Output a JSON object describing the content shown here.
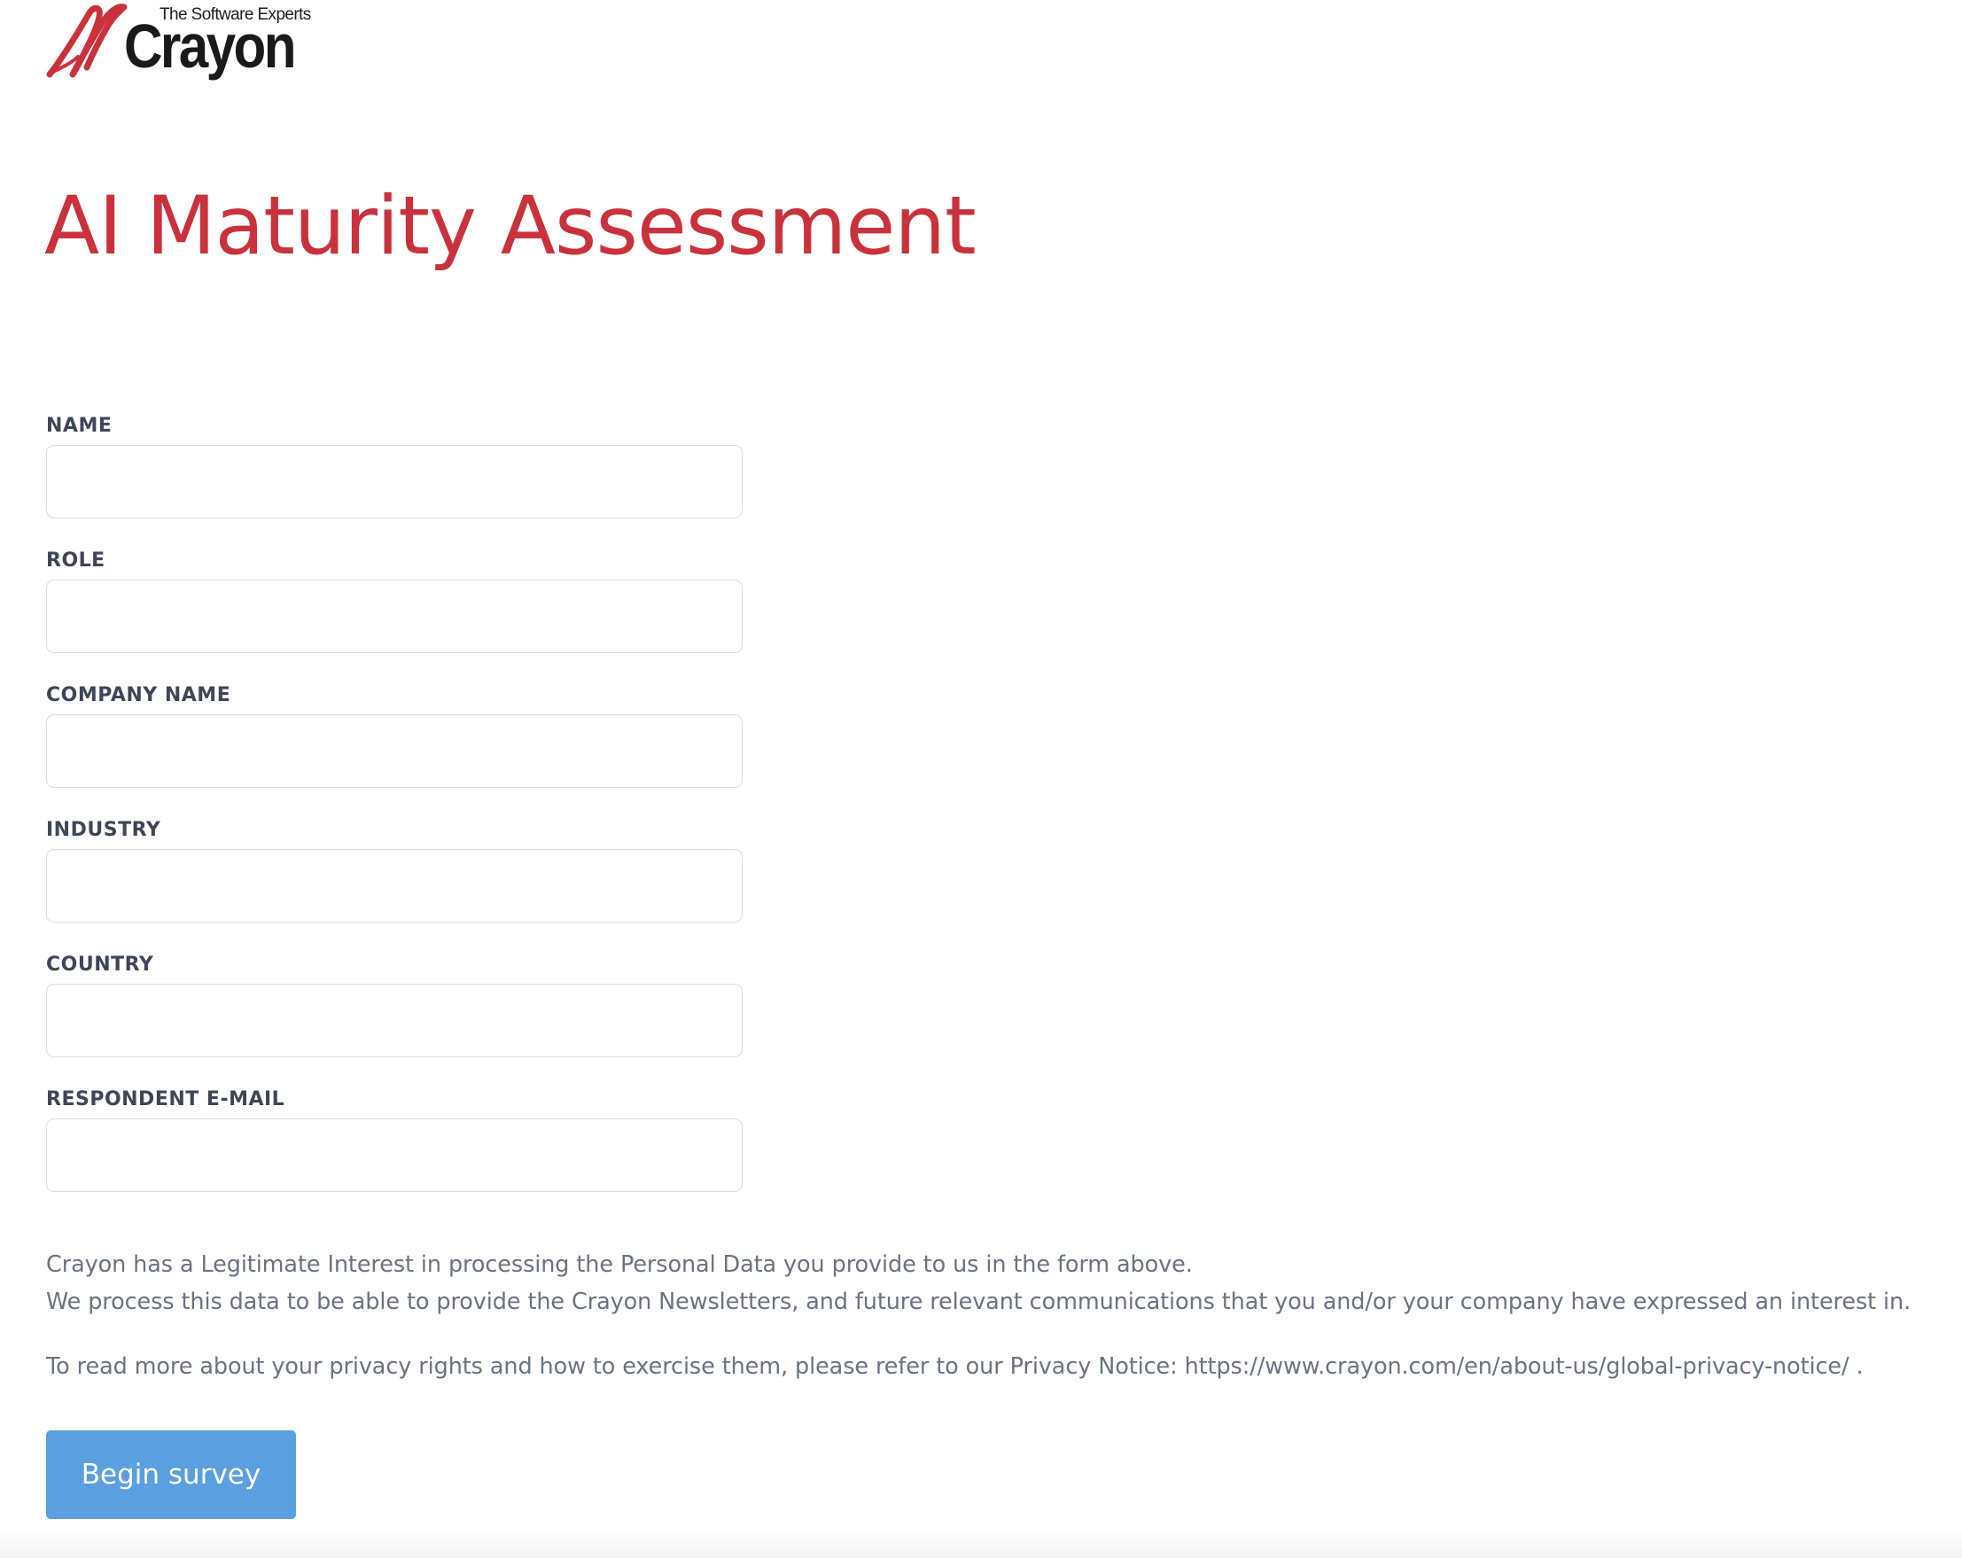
{
  "brand": {
    "tagline": "The Software Experts",
    "wordmark": "Crayon",
    "accent_color": "#c9323c",
    "logo_icon": "crayon-swoosh-icon"
  },
  "page": {
    "title": "AI Maturity Assessment"
  },
  "form": {
    "fields": [
      {
        "label": "NAME",
        "value": "",
        "placeholder": ""
      },
      {
        "label": "ROLE",
        "value": "",
        "placeholder": ""
      },
      {
        "label": "COMPANY NAME",
        "value": "",
        "placeholder": ""
      },
      {
        "label": "INDUSTRY",
        "value": "",
        "placeholder": ""
      },
      {
        "label": "COUNTRY",
        "value": "",
        "placeholder": ""
      },
      {
        "label": "RESPONDENT E-MAIL",
        "value": "",
        "placeholder": ""
      }
    ]
  },
  "notice": {
    "line1": "Crayon has a Legitimate Interest in processing the Personal Data you provide to us in the form above.",
    "line2": "We process this data to be able to provide the Crayon Newsletters, and future relevant communications that you and/or your company have expressed an interest in.",
    "line3": "To read more about your privacy rights and how to exercise them, please refer to our Privacy Notice: https://www.crayon.com/en/about-us/global-privacy-notice/ ."
  },
  "actions": {
    "begin_label": "Begin survey",
    "button_color": "#5b9fe0"
  }
}
